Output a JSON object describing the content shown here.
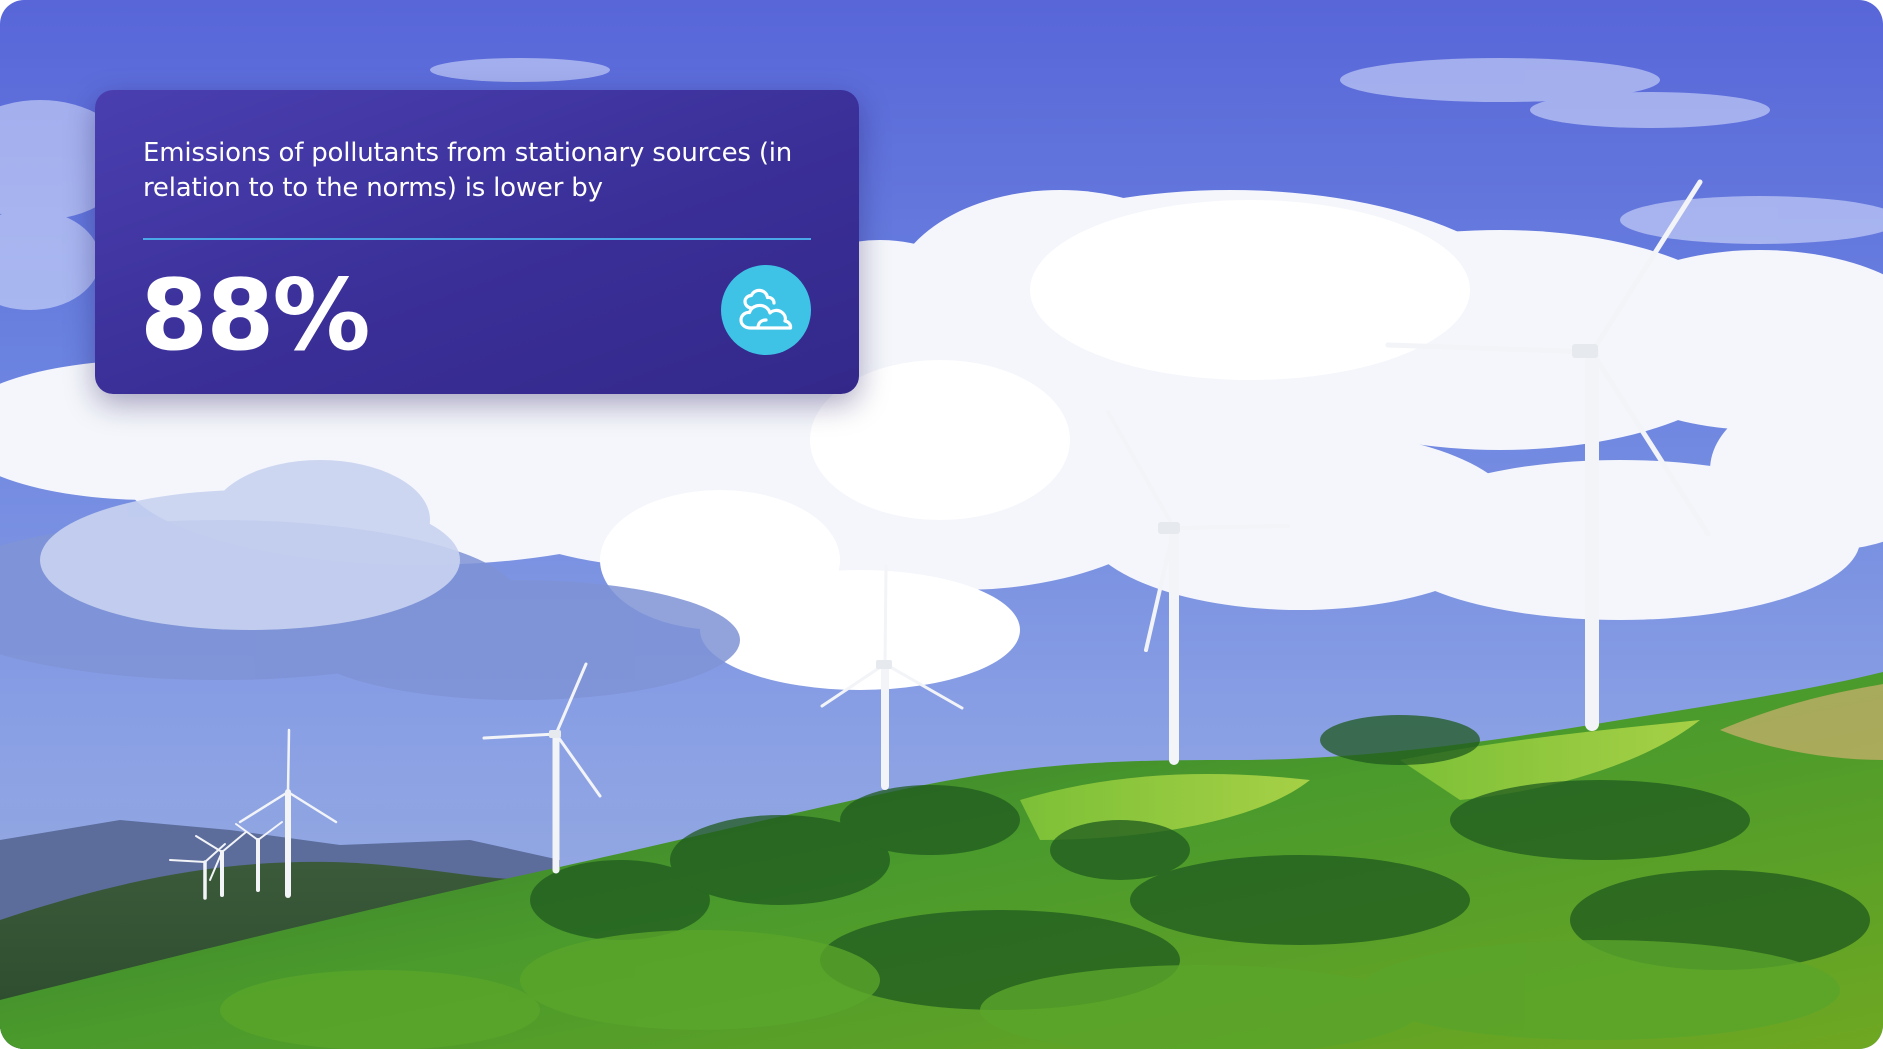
{
  "stat_card": {
    "caption": "Emissions of pollutants from stationary sources (in relation to to the norms) is lower by",
    "value": "88%",
    "icon": "clouds-icon",
    "accent_color": "#3ec3e6",
    "card_color": "#3a2f97"
  },
  "background": {
    "image": "wind-turbines-on-green-hills-under-cloudy-sky"
  }
}
